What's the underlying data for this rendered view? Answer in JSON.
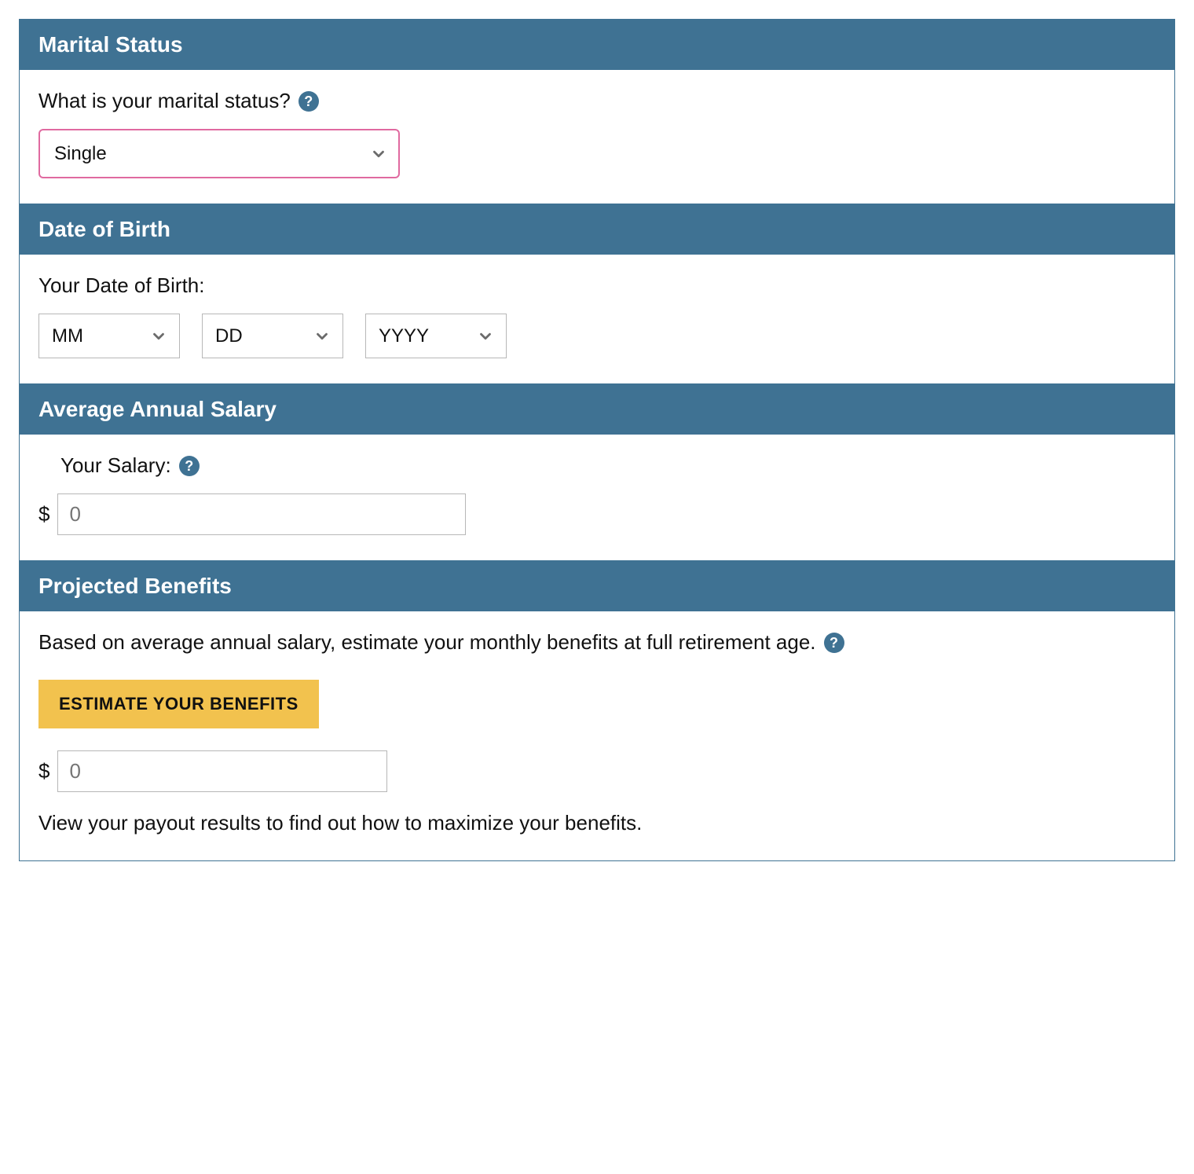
{
  "sections": {
    "marital": {
      "title": "Marital Status",
      "question": "What is your marital status?",
      "selected": "Single"
    },
    "dob": {
      "title": "Date of Birth",
      "label": "Your Date of Birth:",
      "mm": "MM",
      "dd": "DD",
      "yyyy": "YYYY"
    },
    "salary": {
      "title": "Average Annual Salary",
      "label": "Your Salary:",
      "currency": "$",
      "placeholder": "0"
    },
    "benefits": {
      "title": "Projected Benefits",
      "intro": "Based on average annual salary, estimate your monthly benefits at full retirement age.",
      "button": "ESTIMATE YOUR BENEFITS",
      "currency": "$",
      "output_placeholder": "0",
      "footnote": "View your payout results to find out how to maximize your benefits."
    }
  },
  "help_glyph": "?"
}
